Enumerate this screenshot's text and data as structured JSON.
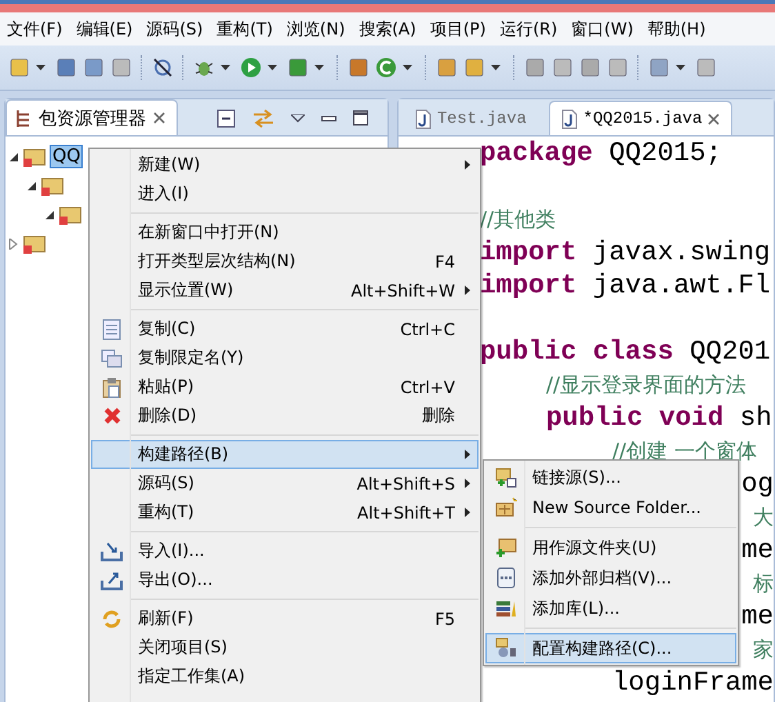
{
  "menu_bar": [
    "文件(F)",
    "编辑(E)",
    "源码(S)",
    "重构(T)",
    "浏览(N)",
    "搜索(A)",
    "项目(P)",
    "运行(R)",
    "窗口(W)",
    "帮助(H)"
  ],
  "explorer": {
    "tab": {
      "label": "包资源管理器",
      "selected": true
    },
    "tree": [
      {
        "label": "QQ",
        "selected": true,
        "expanded": true,
        "children": [
          {
            "expanded": true,
            "children": [
              {
                "expanded": true
              }
            ]
          }
        ]
      },
      {
        "expanded": false
      }
    ]
  },
  "editor": {
    "tabs": [
      {
        "label": "Test.java",
        "selected": false
      },
      {
        "label": "*QQ2015.java",
        "selected": true
      }
    ],
    "lines": [
      {
        "kind": "code",
        "segments": [
          {
            "kind": "keyword",
            "text": "package"
          },
          {
            "kind": "plain",
            "text": " QQ2015;"
          }
        ]
      },
      {
        "kind": "blank"
      },
      {
        "kind": "code",
        "segments": [
          {
            "kind": "comment",
            "text": "//其他类"
          }
        ]
      },
      {
        "kind": "code",
        "segments": [
          {
            "kind": "keyword",
            "text": "import"
          },
          {
            "kind": "plain",
            "text": " javax.swing"
          }
        ]
      },
      {
        "kind": "code",
        "segments": [
          {
            "kind": "keyword",
            "text": "import"
          },
          {
            "kind": "plain",
            "text": " java.awt.Fl"
          }
        ]
      },
      {
        "kind": "blank"
      },
      {
        "kind": "code",
        "segments": [
          {
            "kind": "keyword",
            "text": "public class"
          },
          {
            "kind": "plain",
            "text": " QQ201"
          }
        ],
        "children": [
          {
            "kind": "code",
            "segments": [
              {
                "kind": "comment",
                "text": "//显示登录界面的方法"
              }
            ]
          },
          {
            "kind": "code",
            "segments": [
              {
                "kind": "keyword",
                "text": "public void"
              },
              {
                "kind": "plain",
                "text": " sh"
              }
            ],
            "children": [
              {
                "kind": "code",
                "segments": [
                  {
                    "kind": "comment",
                    "text": "//创建 一个窗体"
                  }
                ]
              },
              {
                "kind": "fragment",
                "segments": [
                  {
                    "kind": "plain",
                    "text": "og"
                  }
                ]
              },
              {
                "kind": "fragment",
                "segments": [
                  {
                    "kind": "comment",
                    "text": "大"
                  }
                ]
              },
              {
                "kind": "fragment",
                "segments": [
                  {
                    "kind": "plain",
                    "text": "me"
                  }
                ]
              },
              {
                "kind": "fragment",
                "segments": [
                  {
                    "kind": "comment",
                    "text": "标"
                  }
                ]
              },
              {
                "kind": "fragment",
                "segments": [
                  {
                    "kind": "plain",
                    "text": "me"
                  }
                ]
              },
              {
                "kind": "fragment",
                "segments": [
                  {
                    "kind": "comment",
                    "text": "家"
                  }
                ]
              },
              {
                "kind": "code",
                "segments": [
                  {
                    "kind": "plain",
                    "text": "loginFrame"
                  }
                ]
              }
            ]
          }
        ]
      }
    ]
  },
  "context_menu": [
    {
      "kind": "item",
      "label": "新建(W)",
      "submenu": true,
      "selected": false
    },
    {
      "kind": "item",
      "label": "进入(I)",
      "selected": false
    },
    {
      "kind": "separator"
    },
    {
      "kind": "item",
      "label": "在新窗口中打开(N)",
      "selected": false
    },
    {
      "kind": "item",
      "label": "打开类型层次结构(N)",
      "shortcut": "F4",
      "selected": false
    },
    {
      "kind": "item",
      "label": "显示位置(W)",
      "shortcut": "Alt+Shift+W",
      "submenu": true,
      "selected": false
    },
    {
      "kind": "separator"
    },
    {
      "kind": "item",
      "label": "复制(C)",
      "shortcut": "Ctrl+C",
      "selected": false
    },
    {
      "kind": "item",
      "label": "复制限定名(Y)",
      "selected": false
    },
    {
      "kind": "item",
      "label": "粘贴(P)",
      "shortcut": "Ctrl+V",
      "selected": false
    },
    {
      "kind": "item",
      "label": "删除(D)",
      "shortcut": "删除",
      "selected": false
    },
    {
      "kind": "separator"
    },
    {
      "kind": "item",
      "label": "构建路径(B)",
      "submenu": true,
      "selected": true
    },
    {
      "kind": "item",
      "label": "源码(S)",
      "shortcut": "Alt+Shift+S",
      "submenu": true,
      "selected": false
    },
    {
      "kind": "item",
      "label": "重构(T)",
      "shortcut": "Alt+Shift+T",
      "submenu": true,
      "selected": false
    },
    {
      "kind": "separator"
    },
    {
      "kind": "item",
      "label": "导入(I)...",
      "selected": false
    },
    {
      "kind": "item",
      "label": "导出(O)...",
      "selected": false
    },
    {
      "kind": "separator"
    },
    {
      "kind": "item",
      "label": "刷新(F)",
      "shortcut": "F5",
      "selected": false
    },
    {
      "kind": "item",
      "label": "关闭项目(S)",
      "selected": false
    },
    {
      "kind": "item",
      "label": "指定工作集(A)",
      "selected": false
    }
  ],
  "build_path_submenu": [
    {
      "kind": "item",
      "label": "链接源(S)...",
      "selected": false
    },
    {
      "kind": "item",
      "label": "New Source Folder...",
      "selected": false
    },
    {
      "kind": "separator"
    },
    {
      "kind": "item",
      "label": "用作源文件夹(U)",
      "selected": false
    },
    {
      "kind": "item",
      "label": "添加外部归档(V)...",
      "selected": false
    },
    {
      "kind": "item",
      "label": "添加库(L)...",
      "selected": false
    },
    {
      "kind": "separator"
    },
    {
      "kind": "item",
      "label": "配置构建路径(C)...",
      "selected": true
    }
  ]
}
